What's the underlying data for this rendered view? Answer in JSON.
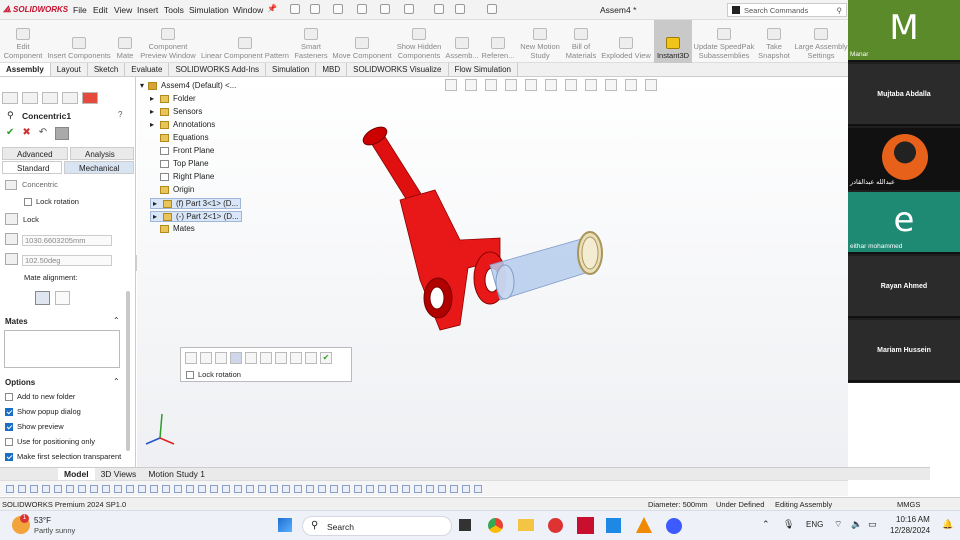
{
  "app": {
    "logo": "SOLIDWORKS",
    "doc_title": "Assem4 *",
    "search_placeholder": "Search Commands"
  },
  "menu": [
    "File",
    "Edit",
    "View",
    "Insert",
    "Tools",
    "Simulation",
    "Window"
  ],
  "ribbon": [
    {
      "label": "Edit\nComponent",
      "active": false
    },
    {
      "label": "Insert Components",
      "active": false
    },
    {
      "label": "Mate",
      "active": false
    },
    {
      "label": "Component\nPreview Window",
      "active": false
    },
    {
      "label": "Linear Component Pattern",
      "active": false
    },
    {
      "label": "Smart\nFasteners",
      "active": false
    },
    {
      "label": "Move Component",
      "active": false
    },
    {
      "label": "Show Hidden\nComponents",
      "active": false
    },
    {
      "label": "Assemb...",
      "active": false
    },
    {
      "label": "Referen...",
      "active": false
    },
    {
      "label": "New Motion\nStudy",
      "active": false
    },
    {
      "label": "Bill of\nMaterials",
      "active": false
    },
    {
      "label": "Exploded View",
      "active": false
    },
    {
      "label": "Instant3D",
      "active": true
    },
    {
      "label": "Update SpeedPak\nSubassemblies",
      "active": false
    },
    {
      "label": "Take\nSnapshot",
      "active": false
    },
    {
      "label": "Large Assembly\nSettings",
      "active": false
    }
  ],
  "tabs": [
    "Assembly",
    "Layout",
    "Sketch",
    "Evaluate",
    "SOLIDWORKS Add-Ins",
    "Simulation",
    "MBD",
    "SOLIDWORKS Visualize",
    "Flow Simulation"
  ],
  "pm": {
    "title": "Concentric1",
    "toggle_advanced": "Advanced",
    "toggle_analysis": "Analysis",
    "toggle_standard": "Standard",
    "toggle_mechanical": "Mechanical",
    "concentric_label": "Concentric",
    "lock_rotation": "Lock rotation",
    "lock": "Lock",
    "distance": "1030.6603205mm",
    "angle": "102.50deg",
    "mate_alignment": "Mate alignment:",
    "mates_header": "Mates",
    "options_header": "Options",
    "options": [
      {
        "label": "Add to new folder",
        "checked": false
      },
      {
        "label": "Show popup dialog",
        "checked": true
      },
      {
        "label": "Show preview",
        "checked": true
      },
      {
        "label": "Use for positioning only",
        "checked": false
      },
      {
        "label": "Make first selection transparent",
        "checked": true
      }
    ]
  },
  "tree": {
    "root": "Assem4 (Default) <...",
    "items": [
      "Folder",
      "Sensors",
      "Annotations",
      "Equations",
      "Front Plane",
      "Top Plane",
      "Right Plane",
      "Origin",
      "(f) Part 3<1> (D...",
      "(-) Part 2<1> (D...",
      "Mates"
    ]
  },
  "popup": {
    "lock_rotation": "Lock rotation"
  },
  "bottom_tabs": [
    "Model",
    "3D Views",
    "Motion Study 1"
  ],
  "status": {
    "product": "SOLIDWORKS Premium 2024 SP1.0",
    "diameter": "Diameter: 500mm",
    "defined": "Under Defined",
    "editing": "Editing Assembly",
    "units": "MMGS"
  },
  "taskbar": {
    "temp": "53°F",
    "weather": "Partly sunny",
    "search": "Search",
    "lang": "ENG",
    "time": "10:16 AM",
    "date": "12/28/2024",
    "badge": "1"
  },
  "meeting": [
    {
      "name": "Manar",
      "avatar": "M",
      "color": "#5a8a2a",
      "style": "avatar"
    },
    {
      "name": "Mujtaba Abdalla",
      "style": "name"
    },
    {
      "name": "عبدالله عبدالقادر",
      "style": "image"
    },
    {
      "name": "eithar mohammed",
      "avatar": "e",
      "color": "#1f8a74",
      "style": "avatar"
    },
    {
      "name": "Rayan Ahmed",
      "style": "name"
    },
    {
      "name": "Mariam Hussein",
      "style": "name"
    }
  ]
}
